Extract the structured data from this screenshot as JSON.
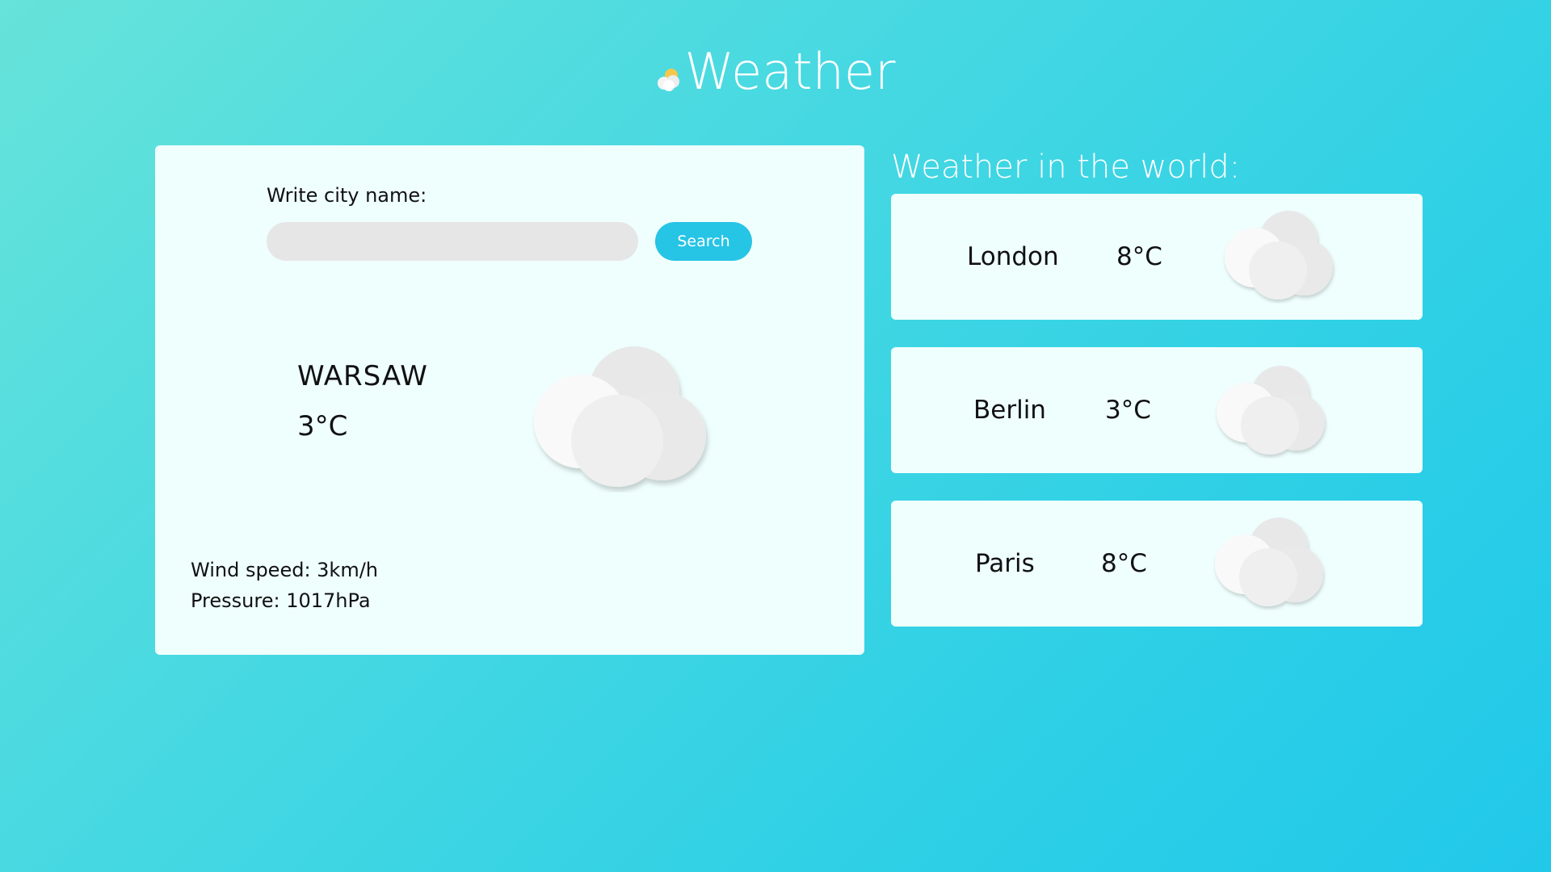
{
  "header": {
    "title": "Weather",
    "logo_icon": "sun-cloud-icon"
  },
  "search": {
    "label": "Write city name:",
    "placeholder": "",
    "value": "",
    "button_label": "Search"
  },
  "current": {
    "city": "WARSAW",
    "temperature": "3°C",
    "icon": "cloud-icon",
    "wind_speed": "Wind speed: 3km/h",
    "pressure": "Pressure: 1017hPa"
  },
  "world": {
    "title": "Weather in the world:",
    "cities": [
      {
        "name": "London",
        "temperature": "8°C",
        "icon": "cloud-icon"
      },
      {
        "name": "Berlin",
        "temperature": "3°C",
        "icon": "cloud-icon"
      },
      {
        "name": "Paris",
        "temperature": "8°C",
        "icon": "cloud-icon"
      }
    ]
  },
  "colors": {
    "background_start": "#66e3da",
    "background_end": "#22c8ea",
    "card": "#effffe",
    "accent": "#26c4e5",
    "input_bg": "#e6e6e6"
  }
}
